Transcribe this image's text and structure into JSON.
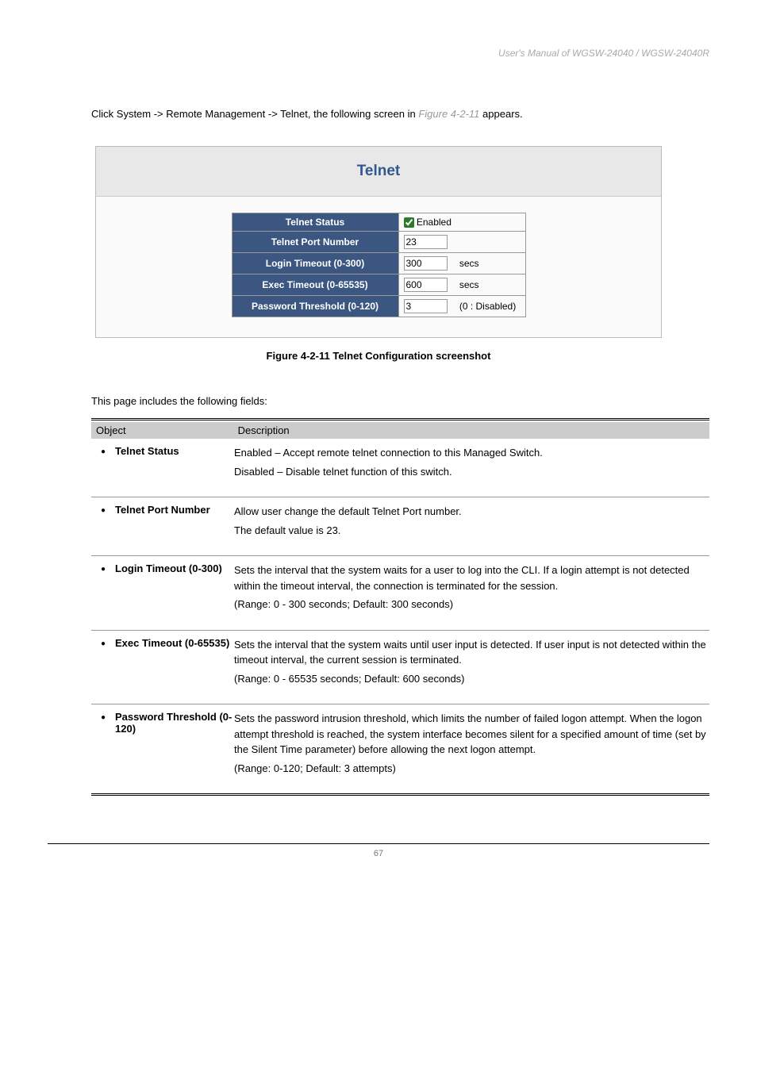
{
  "header": {
    "manual": "User's Manual of WGSW-24040 / WGSW-24040R"
  },
  "intro": {
    "text1": "Click System -> Remote Management -> Telnet, the following screen in ",
    "figref": "Figure 4-2-11",
    "text2": " appears."
  },
  "panel": {
    "title": "Telnet",
    "rows": [
      {
        "label": "Telnet Status",
        "type": "checkbox",
        "checked": true,
        "after": "Enabled"
      },
      {
        "label": "Telnet Port Number",
        "type": "text",
        "value": "23",
        "after": ""
      },
      {
        "label": "Login Timeout (0-300)",
        "type": "text",
        "value": "300",
        "after": "secs"
      },
      {
        "label": "Exec Timeout (0-65535)",
        "type": "text",
        "value": "600",
        "after": "secs"
      },
      {
        "label": "Password Threshold (0-120)",
        "type": "text",
        "value": "3",
        "after": "(0 : Disabled)"
      }
    ]
  },
  "figcap": {
    "ref": "Figure 4-2-11",
    "rest": " Telnet Configuration screenshot"
  },
  "descline": "This page includes the following fields:",
  "objhead": {
    "obj": "Object",
    "desc": "Description"
  },
  "params": [
    {
      "label": "Telnet Status",
      "lines": [
        "Enabled – Accept remote telnet connection to this Managed Switch.",
        "Disabled – Disable telnet function of this switch."
      ]
    },
    {
      "label": "Telnet Port Number",
      "lines": [
        "Allow user change the default Telnet Port number.",
        "The default value is 23."
      ]
    },
    {
      "label": "Login Timeout (0-300)",
      "lines": [
        "Sets the interval that the system waits for a user to log into the CLI. If a login attempt is not detected within the timeout interval, the connection is terminated for the session.",
        "(Range: 0 - 300 seconds; Default: 300 seconds)"
      ]
    },
    {
      "label": "Exec Timeout (0-65535)",
      "lines": [
        "Sets the interval that the system waits until user input is detected. If user input is not detected within the timeout interval, the current session is terminated.",
        "(Range: 0 - 65535 seconds; Default: 600 seconds)"
      ]
    },
    {
      "label": "Password Threshold (0-120)",
      "lines": [
        "Sets the password intrusion threshold, which limits the number of failed logon attempt. When the logon attempt threshold is reached, the system interface becomes silent for a specified amount of time (set by the Silent Time parameter) before allowing the next logon attempt.",
        "(Range: 0-120; Default: 3 attempts)"
      ]
    }
  ],
  "footer": "67"
}
